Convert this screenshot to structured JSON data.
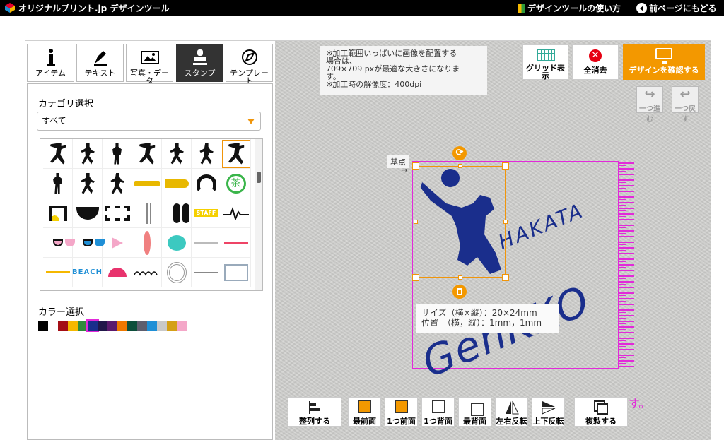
{
  "header": {
    "title": "オリジナルプリント.jp デザインツール",
    "help_label": "デザインツールの使い方",
    "back_label": "前ページにもどる"
  },
  "tabs": [
    {
      "label": "アイテム",
      "icon": "info-icon"
    },
    {
      "label": "テキスト",
      "icon": "pen-icon"
    },
    {
      "label": "写真・データ",
      "icon": "image-icon"
    },
    {
      "label": "スタンプ",
      "icon": "stamp-icon",
      "active": true
    },
    {
      "label": "テンプレート",
      "icon": "template-icon"
    }
  ],
  "category": {
    "label": "カテゴリ選択",
    "selected": "すべて"
  },
  "stamp_icons": [
    "snowboard-stamp",
    "skier-stamp",
    "golfer-stamp",
    "dancer-stamp",
    "runner-stamp",
    "tennis-stamp",
    "volleyball-stamp",
    "basketball-stamp",
    "soccer-stamp",
    "baseball-stamp",
    "trombone-stamp",
    "trumpet-stamp",
    "headphones-stamp",
    "tea-stamp",
    "music-note-stamp",
    "bowl-stamp",
    "film-stamp",
    "hanger-stamp",
    "footprints-stamp",
    "staff-stamp",
    "heartbeat-stamp",
    "heart-sunglasses-stamp",
    "sunglasses-stamp",
    "flag-stamp",
    "surfboard-stamp",
    "turtle-stamp",
    "line-stamp",
    "wave-line-stamp",
    "beach-line-stamp",
    "sunrise-stamp",
    "waves-stamp",
    "rope-stamp",
    "arrow-stamp",
    "frame-stamp",
    "blank-stamp"
  ],
  "staff_text": "STAFF",
  "beach_text": "BEACH",
  "color": {
    "label": "カラー選択",
    "swatches": [
      "#000000",
      "#ffffff",
      "#a40e16",
      "#f5b800",
      "#2e8b3a",
      "#1a2e8c",
      "#21174a",
      "#5b1a6e",
      "#f07800",
      "#0d4f3b",
      "#5e5e6e",
      "#1f8fd6",
      "#c9c9c9",
      "#d4a017",
      "#f4a7c8"
    ],
    "selected_index": 5
  },
  "notice": {
    "lines": [
      "※加工範囲いっぱいに画像を配置する",
      "場合は、",
      "709×709 pxが最適な大きさになりま",
      "す。",
      "※加工時の解像度：400dpi"
    ]
  },
  "toolbar": {
    "grid_label": "グリッド表示",
    "clear_label": "全消去",
    "confirm_label": "デザインを確認する",
    "redo_label": "一つ進む",
    "undo_label": "一つ戻す"
  },
  "design": {
    "kiten_label": "基点",
    "kiten_arrow": "→",
    "text_line1": "HAKATA",
    "text_line2": "GenKKO",
    "size_line": "サイズ（横×縦）：20×24mm",
    "pos_line": "位置　（横，縦）：1mm，1mm",
    "rotate_symbol": "⟳"
  },
  "bottom_note": "ます。",
  "bottom_buttons": {
    "align": "整列する",
    "front": "最前面",
    "forward": "1つ前面",
    "backward": "1つ背面",
    "back": "最背面",
    "flip_h": "左右反転",
    "flip_v": "上下反転",
    "duplicate": "複製する"
  },
  "colors": {
    "accent": "#f39800",
    "print_area": "#e22ad9",
    "navy": "#1a2e8c"
  }
}
